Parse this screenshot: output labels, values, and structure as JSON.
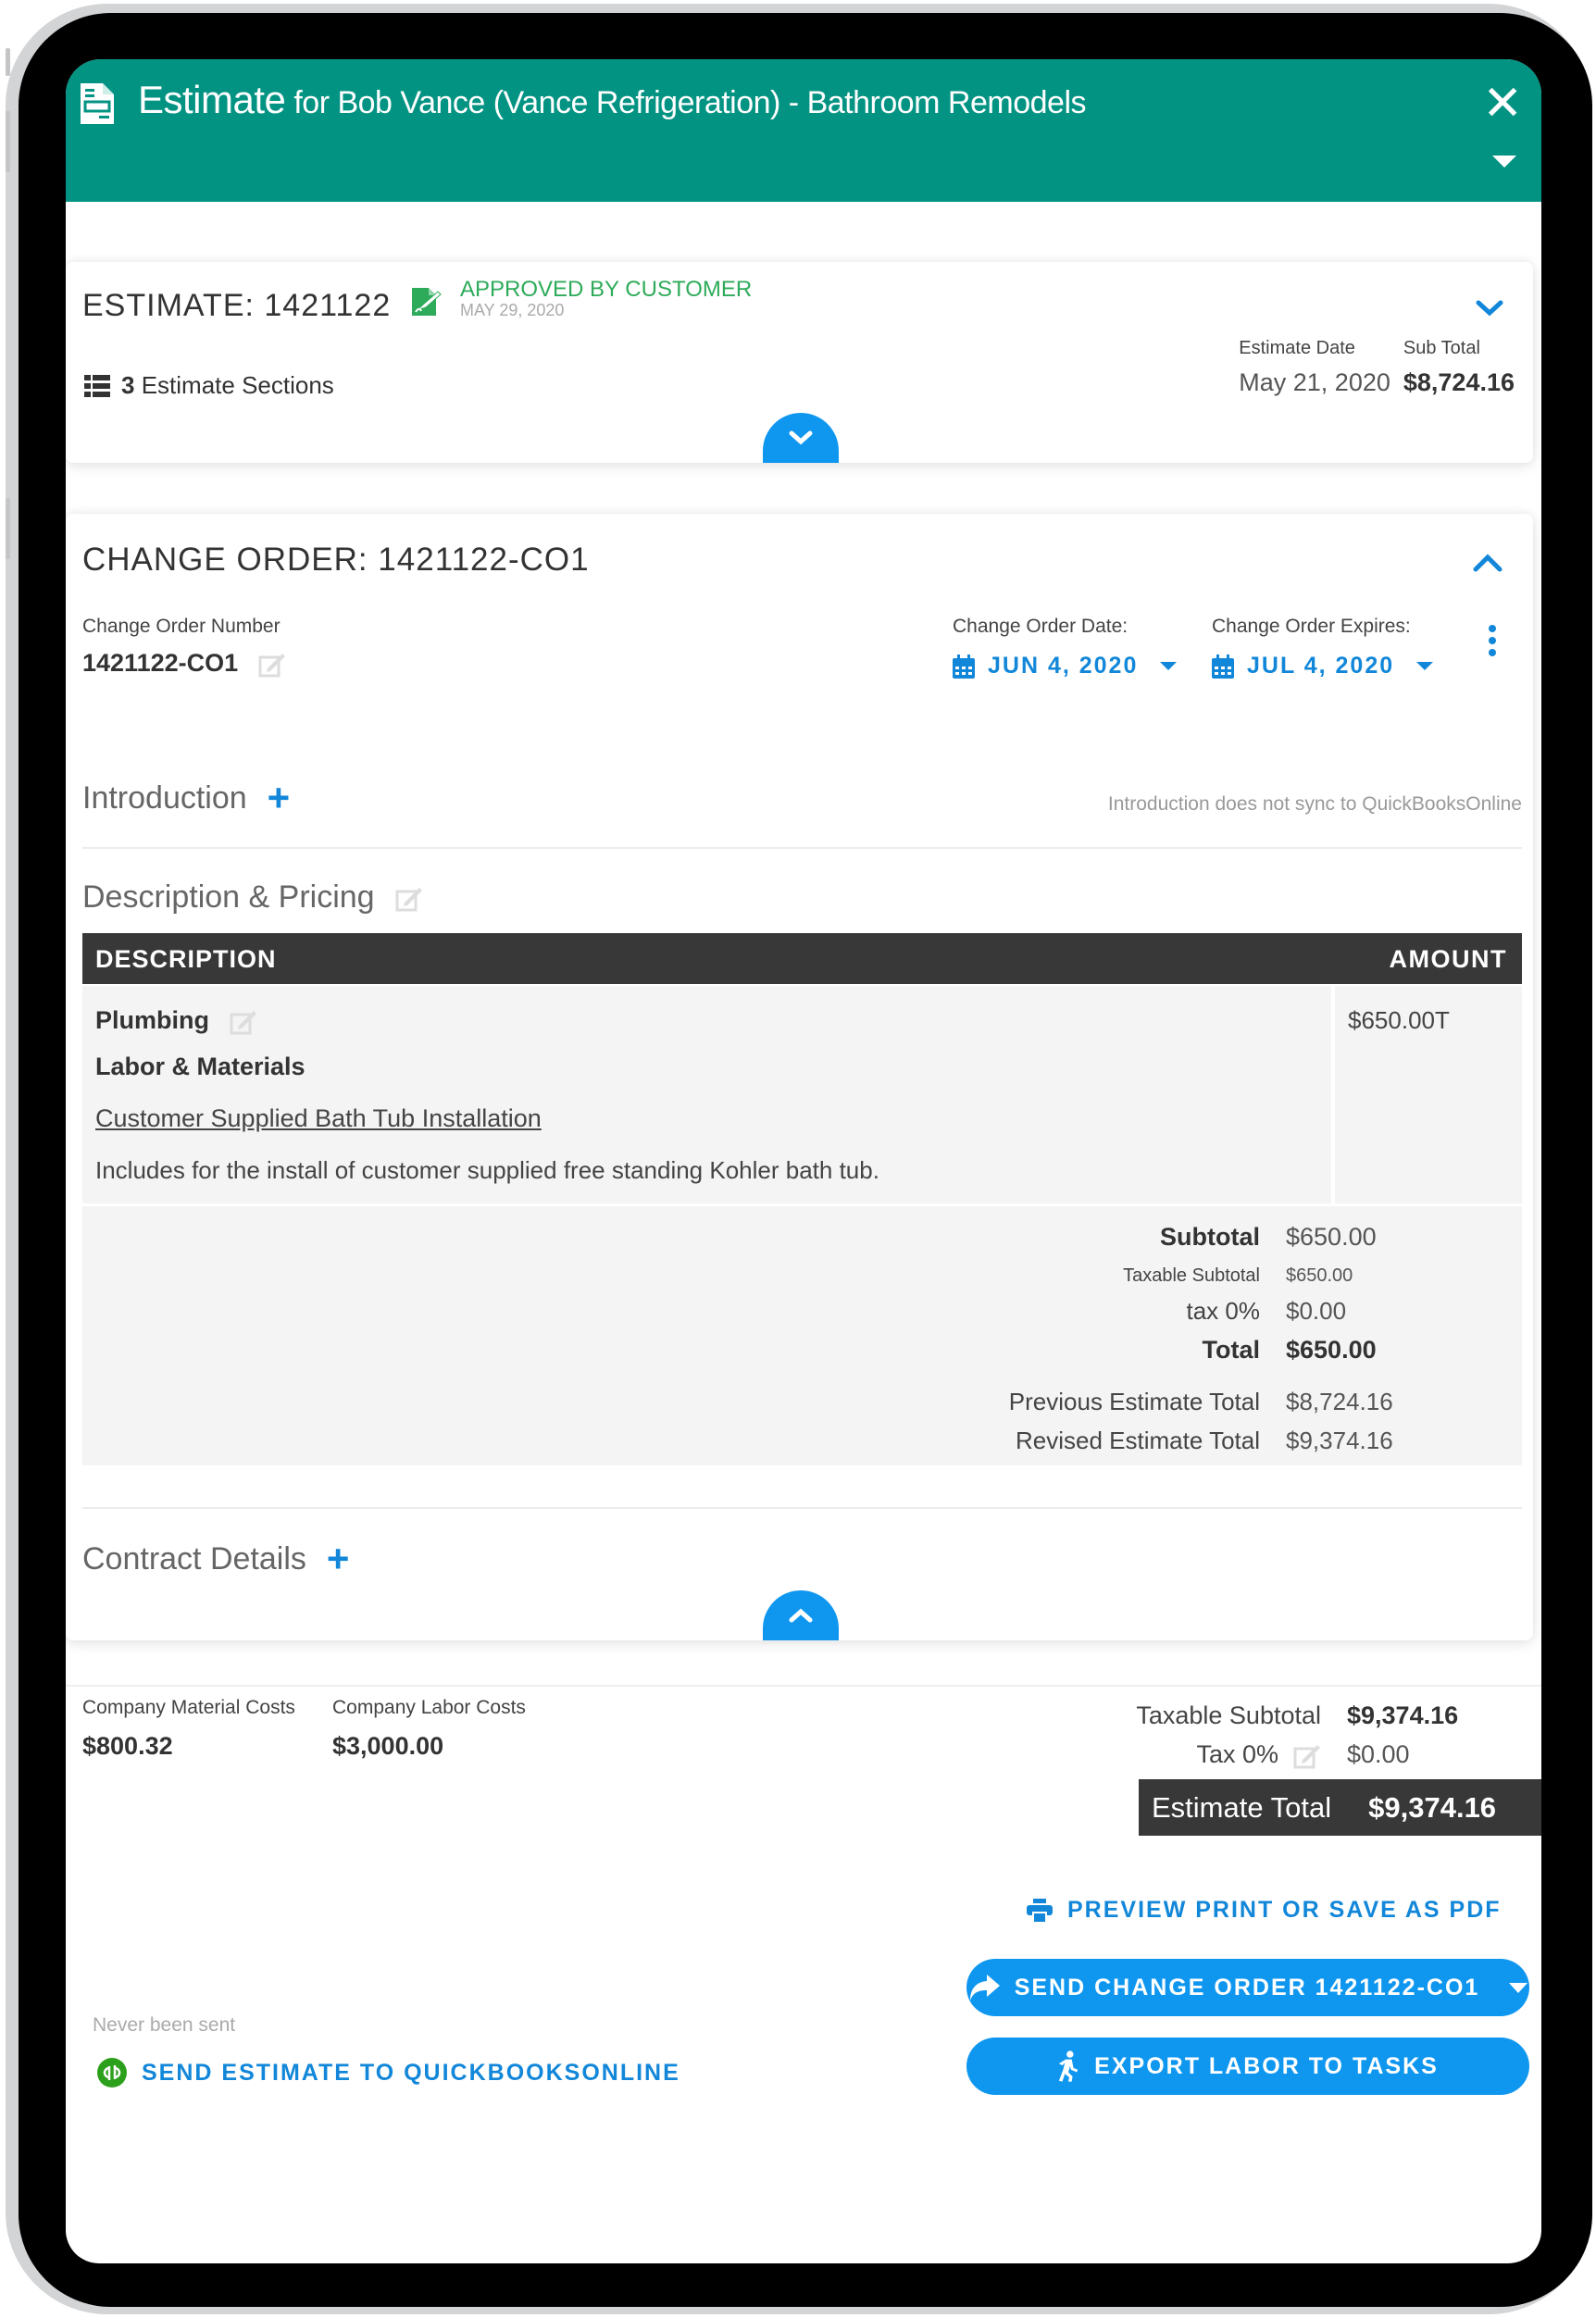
{
  "header": {
    "title_main": "Estimate",
    "title_sub": "for Bob Vance (Vance Refrigeration) - Bathroom Remodels",
    "close_icon": "close-icon",
    "menu_icon": "caret-down-icon"
  },
  "estimate": {
    "title": "ESTIMATE: 1421122",
    "status": "APPROVED BY CUSTOMER",
    "status_date": "MAY 29, 2020",
    "status_color": "#2eab5a",
    "sections_count": "3",
    "sections_label": "Estimate Sections",
    "date_label": "Estimate Date",
    "date_value": "May 21, 2020",
    "subtotal_label": "Sub Total",
    "subtotal_value": "$8,724.16"
  },
  "change_order": {
    "title": "CHANGE ORDER: 1421122-CO1",
    "number_label": "Change Order Number",
    "number_value": "1421122-CO1",
    "date_label": "Change Order Date:",
    "date_value": "JUN 4, 2020",
    "expires_label": "Change Order Expires:",
    "expires_value": "JUL 4, 2020",
    "introduction_label": "Introduction",
    "introduction_note": "Introduction does not sync to QuickBooksOnline",
    "description_label": "Description & Pricing",
    "table": {
      "headers": [
        "DESCRIPTION",
        "AMOUNT"
      ],
      "rows": [
        {
          "title": "Plumbing",
          "subtitle": "Labor & Materials",
          "item": "Customer Supplied Bath Tub Installation",
          "description": "Includes for the install of customer supplied free standing Kohler bath tub.",
          "amount": "$650.00T"
        }
      ]
    },
    "totals": {
      "subtotal_label": "Subtotal",
      "subtotal_value": "$650.00",
      "taxable_subtotal_label": "Taxable Subtotal",
      "taxable_subtotal_value": "$650.00",
      "tax_label": "tax 0%",
      "tax_value": "$0.00",
      "total_label": "Total",
      "total_value": "$650.00",
      "previous_label": "Previous Estimate Total",
      "previous_value": "$8,724.16",
      "revised_label": "Revised Estimate Total",
      "revised_value": "$9,374.16"
    },
    "contract_details_label": "Contract Details"
  },
  "footer": {
    "material_costs_label": "Company Material Costs",
    "material_costs_value": "$800.32",
    "labor_costs_label": "Company Labor Costs",
    "labor_costs_value": "$3,000.00",
    "taxable_subtotal_label": "Taxable Subtotal",
    "taxable_subtotal_value": "$9,374.16",
    "tax_label": "Tax 0%",
    "tax_value": "$0.00",
    "estimate_total_label": "Estimate Total",
    "estimate_total_value": "$9,374.16"
  },
  "actions": {
    "preview_label": "PREVIEW PRINT OR SAVE AS PDF",
    "send_label": "SEND CHANGE ORDER 1421122-CO1",
    "export_label": "EXPORT LABOR TO TASKS",
    "never_sent": "Never been sent",
    "quickbooks_label": "SEND ESTIMATE TO QUICKBOOKSONLINE"
  },
  "colors": {
    "header": "#039383",
    "accent": "#0f97f0",
    "link": "#1287d9",
    "dark_bar": "#383838",
    "quickbooks": "#2ca01c"
  }
}
